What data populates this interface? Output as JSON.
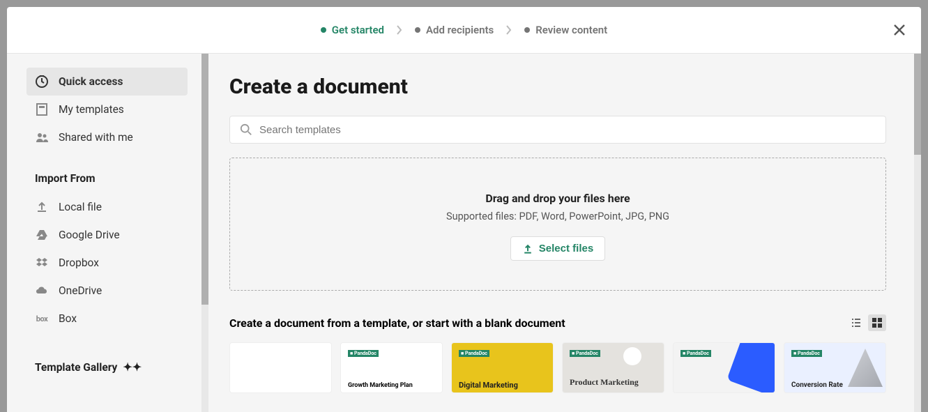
{
  "stepper": {
    "steps": [
      "Get started",
      "Add recipients",
      "Review content"
    ],
    "activeIndex": 0
  },
  "sidebar": {
    "quick": [
      {
        "label": "Quick access",
        "icon": "clock"
      },
      {
        "label": "My templates",
        "icon": "template"
      },
      {
        "label": "Shared with me",
        "icon": "people"
      }
    ],
    "importHeader": "Import From",
    "import": [
      {
        "label": "Local file",
        "icon": "upload"
      },
      {
        "label": "Google Drive",
        "icon": "gdrive"
      },
      {
        "label": "Dropbox",
        "icon": "dropbox"
      },
      {
        "label": "OneDrive",
        "icon": "onedrive"
      },
      {
        "label": "Box",
        "icon": "box"
      }
    ],
    "galleryHeader": "Template Gallery"
  },
  "main": {
    "title": "Create a document",
    "searchPlaceholder": "Search templates",
    "drop": {
      "title": "Drag and drop your files here",
      "subtitle": "Supported files: PDF, Word, PowerPoint, JPG, PNG",
      "button": "Select files"
    },
    "templatesHeader": "Create a document from a template, or start with a blank document",
    "templates": [
      {
        "title": "",
        "style": "blank"
      },
      {
        "title": "Growth Marketing Plan",
        "style": "white"
      },
      {
        "title": "Digital Marketing",
        "style": "yellow"
      },
      {
        "title": "Product Marketing",
        "style": "gray"
      },
      {
        "title": "",
        "style": "blueimg"
      },
      {
        "title": "Conversion Rate",
        "style": "lblue"
      }
    ]
  }
}
